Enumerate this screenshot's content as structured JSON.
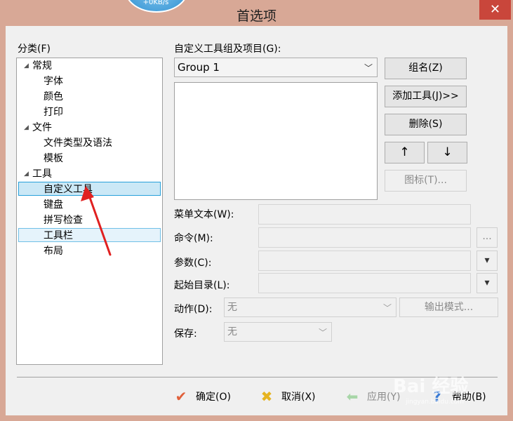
{
  "window": {
    "title": "首选项",
    "close_glyph": "✕",
    "badge_text": "+0KB/s"
  },
  "category": {
    "label": "分类(F)",
    "items": [
      {
        "label": "常规",
        "expandable": true
      },
      {
        "label": "字体"
      },
      {
        "label": "颜色"
      },
      {
        "label": "打印"
      },
      {
        "label": "文件",
        "expandable": true
      },
      {
        "label": "文件类型及语法"
      },
      {
        "label": "模板"
      },
      {
        "label": "工具",
        "expandable": true
      },
      {
        "label": "自定义工具",
        "state": "selected"
      },
      {
        "label": "键盘"
      },
      {
        "label": "拼写检查"
      },
      {
        "label": "工具栏",
        "state": "hover"
      },
      {
        "label": "布局"
      }
    ]
  },
  "tools": {
    "group_label": "自定义工具组及项目(G):",
    "group_value": "Group 1",
    "buttons": {
      "group_name": "组名(Z)",
      "add_tool": "添加工具(J)>>",
      "delete": "删除(S)",
      "up": "↑",
      "down": "↓",
      "icon": "图标(T)..."
    }
  },
  "fields": {
    "menu_text": "菜单文本(W):",
    "command": "命令(M):",
    "command_browse": "...",
    "params": "参数(C):",
    "start_dir": "起始目录(L):",
    "dropdown_glyph": "▾",
    "action_label": "动作(D):",
    "action_value": "无",
    "output_mode": "输出模式...",
    "save_label": "保存:",
    "save_value": "无"
  },
  "footer": {
    "ok": "确定(O)",
    "cancel": "取消(X)",
    "apply": "应用(Y)",
    "help": "帮助(B)"
  },
  "watermark": {
    "text": "Bai 经验",
    "sub": "jingyan.baidu.com"
  },
  "colors": {
    "frame": "#d8a896",
    "close_button": "#c9463b",
    "selection": "#cbe8f6",
    "selection_border": "#26a0da",
    "annotation_arrow": "#e02020"
  }
}
